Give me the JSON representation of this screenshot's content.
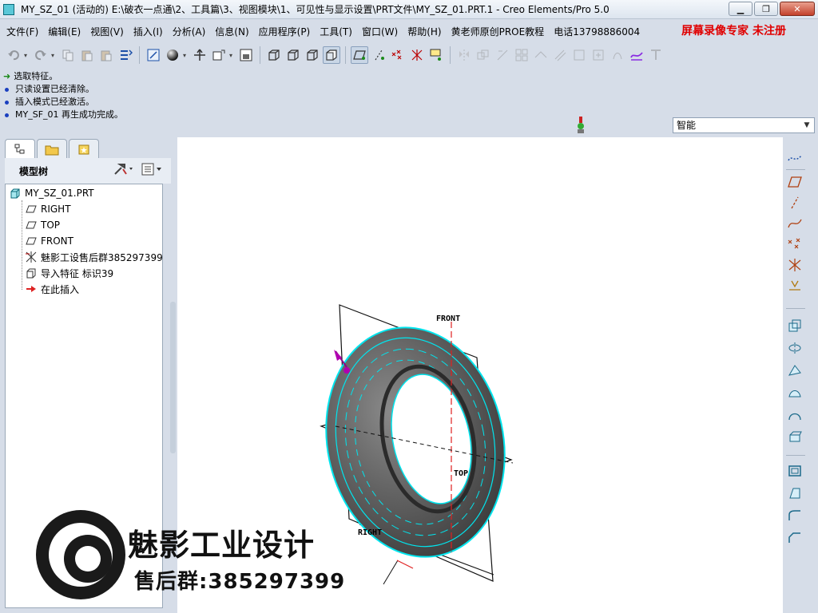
{
  "window": {
    "title": "MY_SZ_01 (活动的) E:\\破衣一点通\\2、工具篇\\3、视图模块\\1、可见性与显示设置\\PRT文件\\MY_SZ_01.PRT.1 - Creo Elements/Pro 5.0",
    "minimize": "▁",
    "restore": "❐",
    "close": "✕"
  },
  "menu": {
    "items": [
      "文件(F)",
      "编辑(E)",
      "视图(V)",
      "插入(I)",
      "分析(A)",
      "信息(N)",
      "应用程序(P)",
      "工具(T)",
      "窗口(W)",
      "帮助(H)",
      "黄老师原创PROE教程",
      "电话13798886004"
    ],
    "promo": "屏幕录像专家  未注册"
  },
  "messages": [
    {
      "icon": "green-arrow-icon",
      "text": "选取特征。"
    },
    {
      "icon": "bullet-icon",
      "text": "只读设置已经清除。"
    },
    {
      "icon": "bullet-icon",
      "text": "插入模式已经激活。"
    },
    {
      "icon": "bullet-icon",
      "text": "MY_SF_01 再生成功完成。"
    }
  ],
  "filter": {
    "value": "智能"
  },
  "model_tree": {
    "title": "模型树",
    "root": "MY_SZ_01.PRT",
    "items": [
      {
        "label": "RIGHT",
        "icon": "datum-plane-icon"
      },
      {
        "label": "TOP",
        "icon": "datum-plane-icon"
      },
      {
        "label": "FRONT",
        "icon": "datum-plane-icon"
      },
      {
        "label": "魅影工设售后群385297399",
        "icon": "csys-icon"
      },
      {
        "label": "导入特征 标识39",
        "icon": "import-feature-icon"
      },
      {
        "label": "在此插入",
        "icon": "insert-here-arrow-icon"
      }
    ]
  },
  "viewport": {
    "plane_labels": {
      "front": "FRONT",
      "top": "TOP",
      "right": "RIGHT"
    }
  },
  "watermark": {
    "brand": "魅影工业设计",
    "group": "售后群:385297399"
  },
  "colors": {
    "wireframe": "#00e5ee",
    "tire_shade": "#5c5c5c",
    "promo_red": "#e00000",
    "datum_red": "#e02020"
  }
}
